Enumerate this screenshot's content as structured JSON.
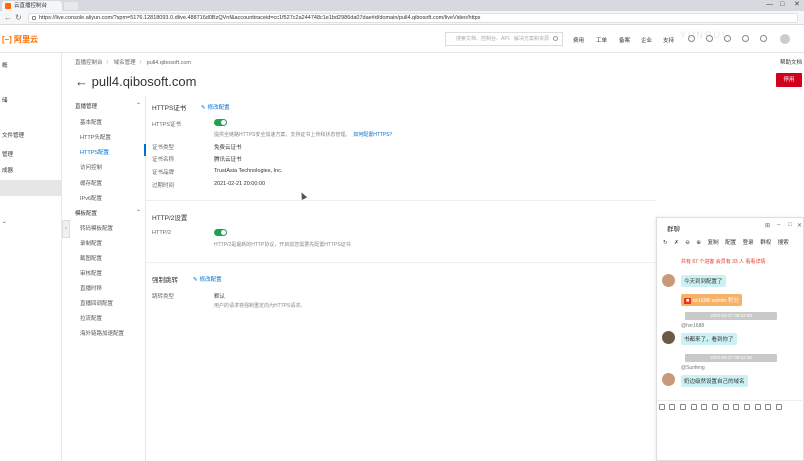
{
  "browser": {
    "tab_title": "云直播控制台",
    "url": "https://live.console.aliyun.com/?spm=5176.12818093.0.dlive.488716d0BzQVnf&accounttraceid=cc1f527c2a244748c1e1bd2986da07dae#d/domain/pull4.qibosoft.com/liveVideo/https",
    "min": "—",
    "max": "□",
    "close": "✕"
  },
  "topnav": {
    "logo": "阿里云",
    "search_placeholder": "搜索文档、控制台、API、解决方案和资源",
    "items": [
      "费用",
      "工单",
      "备案",
      "企业",
      "支持"
    ]
  },
  "leftnav": {
    "items": [
      "概",
      "",
      "储",
      "文件管理",
      "管理",
      "",
      "成器",
      "",
      "",
      ""
    ]
  },
  "breadcrumb": [
    "直播控制台",
    "域名管理",
    "pull4.qibosoft.com"
  ],
  "page_title": "pull4.qibosoft.com",
  "help_link": "帮助文档",
  "action_button": "停用",
  "subnav": {
    "groups": [
      {
        "label": "直播管理",
        "items": [
          "基本配置",
          "HTTP头配置",
          "HTTPS配置",
          "访问控制",
          "缓存配置",
          "IPv6配置"
        ]
      },
      {
        "label": "模板配置",
        "items": [
          "转码模板配置",
          "录制配置",
          "截图配置",
          "审核配置",
          "直播时移",
          "直播回调配置",
          "拉流配置",
          "海外链路加速配置"
        ]
      }
    ]
  },
  "https_section": {
    "title": "HTTPS证书",
    "edit": "修改配置",
    "cert_label": "HTTPS证书",
    "hint": "提供全链路HTTPS安全加速方案，支持证书上传和状态管理。",
    "hint_link": "如何配置HTTPS？",
    "rows": [
      {
        "label": "证书类型",
        "value": "免费云证书"
      },
      {
        "label": "证书名称",
        "value": "腾讯云证书"
      },
      {
        "label": "证书品牌",
        "value": "TrustAsia Technologies, Inc."
      },
      {
        "label": "过期时间",
        "value": "2021-02-21 20:00:00"
      }
    ]
  },
  "http2_section": {
    "title": "HTTP/2设置",
    "label": "HTTP/2",
    "hint": "HTTP/2是最新的HTTP协议，开启前您需要先配置HTTPS证书"
  },
  "redirect_section": {
    "title": "强制跳转",
    "edit": "修改配置",
    "label": "跳转类型",
    "value": "默认",
    "hint": "用户的请求将强制重定向为HTTPS请求。"
  },
  "chat": {
    "title": "群聊",
    "tools": [
      "复制",
      "配置",
      "登录",
      "群权",
      "搜索"
    ],
    "notice": "共有 67 个进客 会员有 33 人 看看详情",
    "messages": [
      {
        "name": "",
        "text": "今天到到配置了"
      },
      {
        "name": "",
        "text": "or1688  admin  积分",
        "orange": true
      },
      {
        "ts": "2020-03-27 09:52:09"
      },
      {
        "name": "@hxr1688",
        "text": "书都来了，看到你了"
      },
      {
        "ts": "2020-03-27 09:53:38"
      },
      {
        "name": "@Sunfeng",
        "text": "奶边级然设置自己的域名"
      }
    ]
  },
  "watermark": "YUNRUI"
}
